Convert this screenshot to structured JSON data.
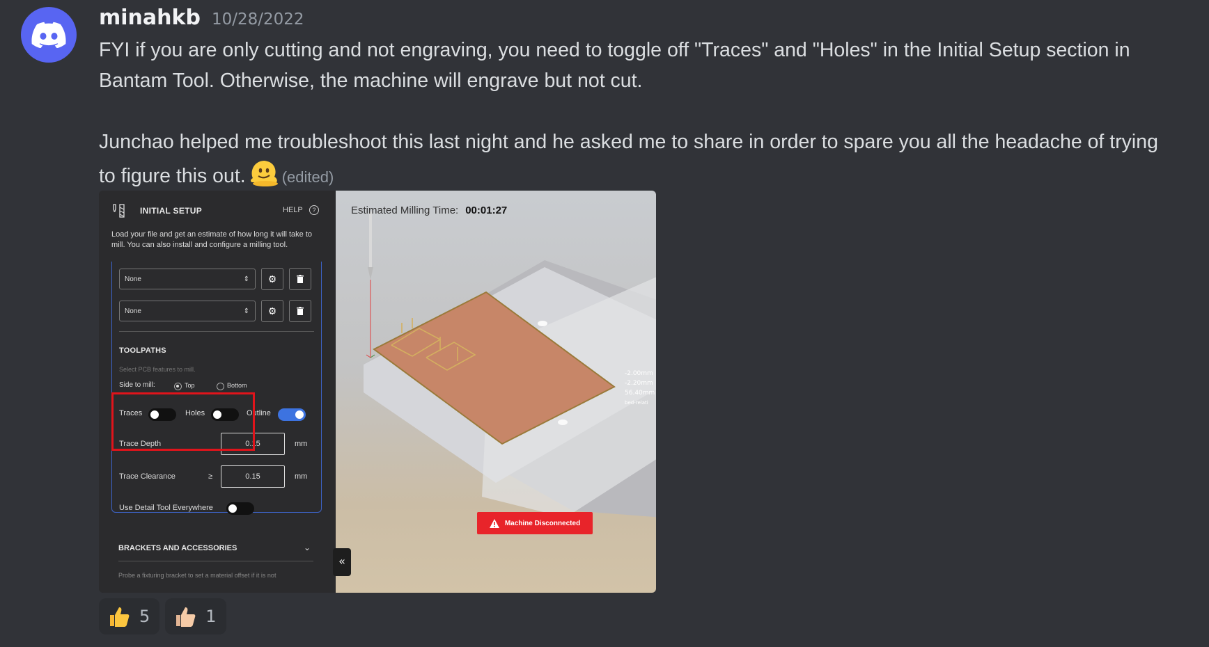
{
  "message": {
    "username": "minahkb",
    "timestamp": "10/28/2022",
    "paragraph1": "FYI if you are only cutting and not engraving, you need to toggle off \"Traces\" and \"Holes\" in the Initial Setup section in Bantam Tool. Otherwise, the machine will engrave but not cut.",
    "paragraph2": "Junchao helped me troubleshoot this last night and he asked me to share in order to spare you all the headache of trying to figure this out.",
    "emoji": "melting-face",
    "edited": "(edited)"
  },
  "attachment": {
    "panel": {
      "title": "INITIAL SETUP",
      "help": "HELP",
      "description": "Load your file and get an estimate of how long it will take to mill. You can also install and configure a milling tool.",
      "tool_select_1": "None",
      "tool_select_2": "None",
      "toolpaths_title": "TOOLPATHS",
      "toolpaths_desc": "Select PCB features to mill.",
      "side_label": "Side to mill:",
      "side_top": "Top",
      "side_bottom": "Bottom",
      "side_selected": "Top",
      "traces_label": "Traces",
      "traces_on": false,
      "holes_label": "Holes",
      "holes_on": false,
      "outline_label": "Outline",
      "outline_on": true,
      "trace_depth_label": "Trace Depth",
      "trace_depth_value": "0.15",
      "trace_depth_unit": "mm",
      "trace_clearance_label": "Trace Clearance",
      "trace_clearance_op": "≥",
      "trace_clearance_value": "0.15",
      "trace_clearance_unit": "mm",
      "detail_tool_label": "Use Detail Tool Everywhere",
      "detail_tool_on": false,
      "brackets_title": "BRACKETS AND ACCESSORIES",
      "brackets_desc": "Probe a fixturing bracket to set a material offset if it is not",
      "collapse_label": "«"
    },
    "viewport": {
      "est_label": "Estimated Milling Time:",
      "est_value": "00:01:27",
      "dim1": "-2.00mm",
      "dim2": "-2.20mm",
      "dim3": "56.40mm",
      "dim4": "bed-relati",
      "status": "Machine Disconnected",
      "status_color": "#e8242a"
    }
  },
  "reactions": [
    {
      "emoji": "thumbs-up",
      "count": "5"
    },
    {
      "emoji": "thumbs-up-light",
      "count": "1"
    }
  ],
  "colors": {
    "background": "#313338",
    "avatar": "#5865f2",
    "accent_blue": "#3d73e0",
    "highlight_red": "#e0141b"
  }
}
